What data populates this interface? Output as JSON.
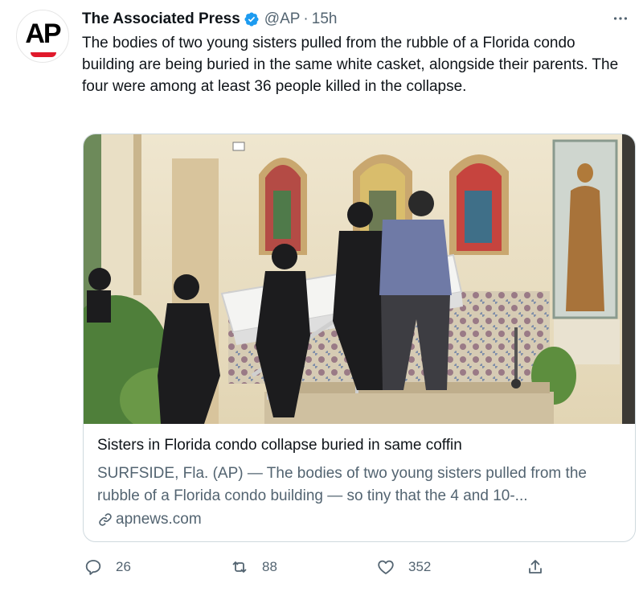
{
  "account": {
    "name": "The Associated Press",
    "handle": "@AP",
    "separator": "·",
    "time": "15h",
    "avatar_text": "AP"
  },
  "tweet": {
    "text": "The bodies of two young sisters pulled from the rubble of a Florida condo building are being buried in the same white casket, alongside their parents. The four were among at least 36 people killed in the collapse."
  },
  "card": {
    "title": "Sisters in Florida condo collapse buried in same coffin",
    "description": "SURFSIDE, Fla. (AP) — The bodies of two young sisters pulled from the rubble of a Florida condo building — so tiny that the 4 and 10-...",
    "domain": "apnews.com"
  },
  "actions": {
    "replies": "26",
    "retweets": "88",
    "likes": "352"
  },
  "icons": {
    "verified": "verified-badge-icon",
    "more": "more-icon",
    "link": "link-icon",
    "reply": "reply-icon",
    "retweet": "retweet-icon",
    "like": "heart-icon",
    "share": "share-icon"
  },
  "colors": {
    "verified": "#1d9bf0",
    "secondary_text": "#536471",
    "brand_red": "#e0192b"
  }
}
